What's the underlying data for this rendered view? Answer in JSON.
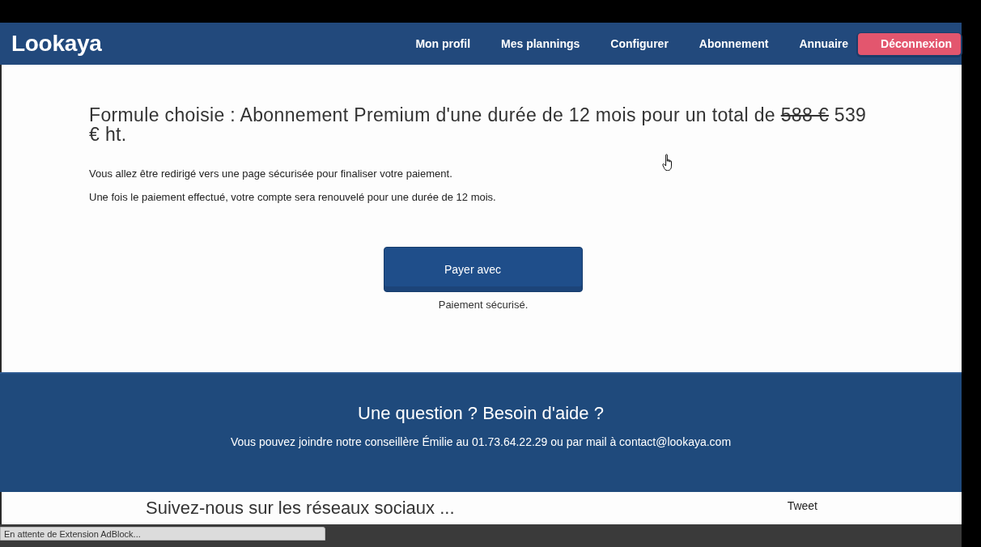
{
  "header": {
    "logo": "Lookaya",
    "nav": [
      {
        "label": "Mon profil",
        "kind": "link"
      },
      {
        "label": "Mes plannings",
        "kind": "link"
      },
      {
        "label": "Configurer",
        "kind": "link"
      },
      {
        "label": "Abonnement",
        "kind": "link"
      },
      {
        "label": "Annuaire",
        "kind": "link"
      },
      {
        "label": "Déconnexion",
        "kind": "button"
      }
    ]
  },
  "summary": {
    "heading": {
      "text": "Formule choisie : Abonnement Premium d'une durée de 12 mois pour un total de",
      "old_price": "588 €",
      "price": "539 € ht."
    },
    "paragraphs": [
      "Vous allez être redirigé vers une page sécurisée pour finaliser votre paiement.",
      "Une fois le paiement effectué, votre compte sera renouvelé pour une durée de 12 mois."
    ],
    "pay_button": "Payer avec",
    "secure_note": "Paiement sécurisé."
  },
  "help": {
    "title": "Une question ? Besoin d'aide ?",
    "text": "Vous pouvez joindre notre conseillère Émilie au 01.73.64.22.29 ou par mail à contact@lookaya.com"
  },
  "social": {
    "title": "Suivez-nous sur les réseaux sociaux ...",
    "tweet": "Tweet"
  },
  "status_bar": {
    "text": "En attente de Extension AdBlock..."
  }
}
